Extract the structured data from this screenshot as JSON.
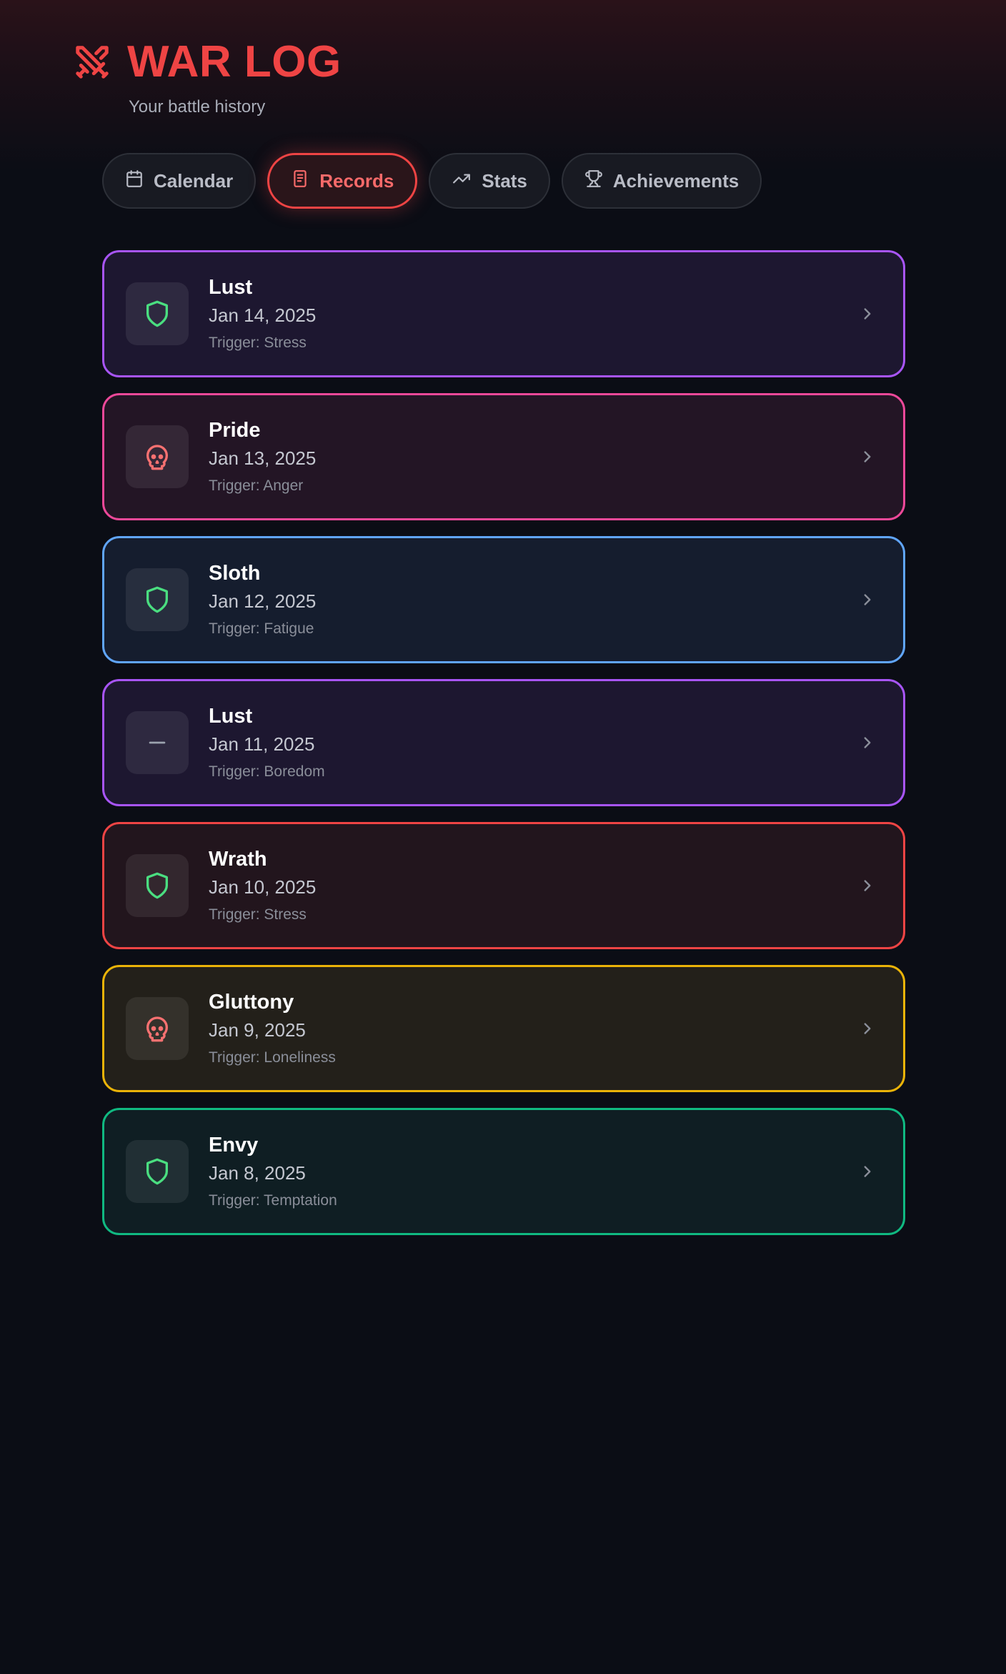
{
  "app": {
    "title": "WAR LOG",
    "subtitle": "Your battle history",
    "accent": "#ef4444"
  },
  "tabs": [
    {
      "label": "Calendar",
      "icon": "calendar-icon",
      "active": false
    },
    {
      "label": "Records",
      "icon": "document-icon",
      "active": true
    },
    {
      "label": "Stats",
      "icon": "trending-up-icon",
      "active": false
    },
    {
      "label": "Achievements",
      "icon": "trophy-icon",
      "active": false
    }
  ],
  "records": [
    {
      "sin": "Lust",
      "date": "Jan 14, 2025",
      "trigger": "Trigger: Stress",
      "status": "shield-icon",
      "border": "#a855f7",
      "bg": "#1d1730"
    },
    {
      "sin": "Pride",
      "date": "Jan 13, 2025",
      "trigger": "Trigger: Anger",
      "status": "skull-icon",
      "border": "#ec4899",
      "bg": "#231525"
    },
    {
      "sin": "Sloth",
      "date": "Jan 12, 2025",
      "trigger": "Trigger: Fatigue",
      "status": "shield-icon",
      "border": "#60a5fa",
      "bg": "#151d2e"
    },
    {
      "sin": "Lust",
      "date": "Jan 11, 2025",
      "trigger": "Trigger: Boredom",
      "status": "dash-icon",
      "border": "#a855f7",
      "bg": "#1d1730"
    },
    {
      "sin": "Wrath",
      "date": "Jan 10, 2025",
      "trigger": "Trigger: Stress",
      "status": "shield-icon",
      "border": "#ef4444",
      "bg": "#22151d"
    },
    {
      "sin": "Gluttony",
      "date": "Jan 9, 2025",
      "trigger": "Trigger: Loneliness",
      "status": "skull-icon",
      "border": "#eab308",
      "bg": "#23201a"
    },
    {
      "sin": "Envy",
      "date": "Jan 8, 2025",
      "trigger": "Trigger: Temptation",
      "status": "shield-icon",
      "border": "#10b981",
      "bg": "#0f1e23"
    }
  ],
  "colors": {
    "shield": "#4ade80",
    "skull": "#f87171",
    "dash": "#9ca3af",
    "chevron": "#8b8f9a"
  }
}
